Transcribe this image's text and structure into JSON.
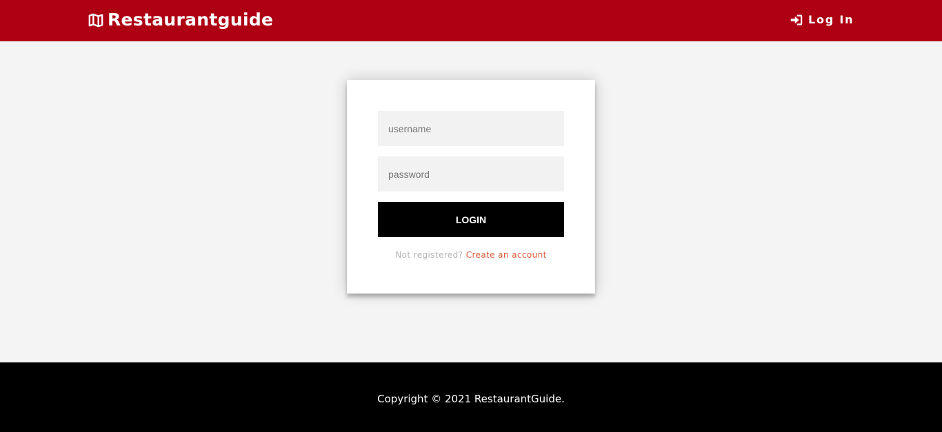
{
  "navbar": {
    "brand_prefix": "Restaurant",
    "brand_suffix": "guide",
    "brand_icon": "map-icon",
    "login_label": "Log In",
    "login_icon": "sign-in-icon",
    "background": "#ae0013"
  },
  "login_form": {
    "username_placeholder": "username",
    "password_placeholder": "password",
    "submit_label": "LOGIN",
    "register_prompt": "Not registered?",
    "register_link": "Create an account",
    "link_color": "#de5b3a"
  },
  "footer": {
    "copyright": "Copyright © 2021 RestaurantGuide."
  }
}
